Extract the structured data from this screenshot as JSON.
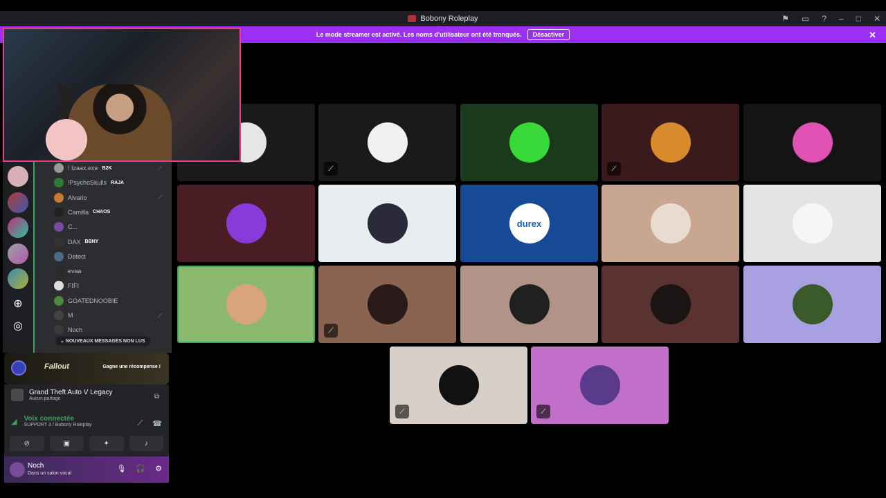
{
  "window": {
    "title": "Bobony Roleplay",
    "controls": [
      "flag-icon",
      "inbox-icon",
      "help-icon",
      "minimize-icon",
      "maximize-icon",
      "close-icon"
    ]
  },
  "banner": {
    "text": "Le mode streamer est activé. Les noms d'utilisateur ont été tronqués.",
    "button": "Désactiver",
    "close": "✕"
  },
  "members": [
    {
      "name": "! Izaax.exe",
      "tag": "B2K",
      "muted": true,
      "color": "#9a9a9a"
    },
    {
      "name": "!PsychoSkulls",
      "tag": "RAJA",
      "muted": false,
      "color": "#2e7d32"
    },
    {
      "name": "Alvario",
      "tag": "",
      "muted": true,
      "color": "#c97a32"
    },
    {
      "name": "Camilla",
      "tag": "CHAOS",
      "muted": false,
      "color": "#222222"
    },
    {
      "name": "C...",
      "tag": "",
      "muted": false,
      "color": "#7a4aa0"
    },
    {
      "name": "DAX",
      "tag": "BBNY",
      "muted": false,
      "color": "#333333"
    },
    {
      "name": "Detect",
      "tag": "",
      "muted": false,
      "color": "#4a6a8a"
    },
    {
      "name": "evaa",
      "tag": "",
      "muted": false,
      "color": "#2a2a2a"
    },
    {
      "name": "FIFI",
      "tag": "",
      "muted": false,
      "color": "#dddddd"
    },
    {
      "name": "GOATEDNOOBIE",
      "tag": "",
      "muted": false,
      "color": "#4a8a3a"
    },
    {
      "name": "M",
      "tag": "",
      "muted": true,
      "color": "#444444"
    },
    {
      "name": "Noch",
      "tag": "",
      "muted": false,
      "color": "#3a3a3a"
    }
  ],
  "new_messages": "NOUVEAUX MESSAGES NON LUS",
  "promo": {
    "brand": "Fallout",
    "cta": "Gagne une récompense !"
  },
  "game": {
    "name": "Grand Theft Auto V Legacy",
    "status": "Aucun partage"
  },
  "voice": {
    "status": "Voix connectée",
    "channel": "SUPPORT 3 / Bobony Roleplay"
  },
  "user": {
    "name": "Noch",
    "status": "Dans un salon vocal"
  },
  "tiles": [
    {
      "bg": "#1a1a1a",
      "avatar": "#e6e6e6",
      "muted": false,
      "speaking": false
    },
    {
      "bg": "#1a1a1a",
      "avatar": "#f0f0f0",
      "muted": true,
      "speaking": false
    },
    {
      "bg": "#1b3a1b",
      "avatar": "#39d93a",
      "muted": false,
      "speaking": false
    },
    {
      "bg": "#3a1a1a",
      "avatar": "#d98a2a",
      "muted": true,
      "speaking": false
    },
    {
      "bg": "#141414",
      "avatar": "#e052b4",
      "muted": false,
      "speaking": false
    },
    {
      "bg": "#4a1c24",
      "avatar": "#8a3ad9",
      "muted": false,
      "speaking": false
    },
    {
      "bg": "#e8eef0",
      "avatar": "#2a2a3a",
      "muted": false,
      "speaking": false
    },
    {
      "bg": "#164a94",
      "avatar": "#ffffff",
      "muted": false,
      "speaking": false,
      "label": "durex"
    },
    {
      "bg": "#c8a690",
      "avatar": "#e8dcd0",
      "muted": false,
      "speaking": false
    },
    {
      "bg": "#e4e4e2",
      "avatar": "#f6f6f6",
      "muted": false,
      "speaking": false
    },
    {
      "bg": "#8cb870",
      "avatar": "#d9a47a",
      "muted": false,
      "speaking": true
    },
    {
      "bg": "#8a6452",
      "avatar": "#2a1a1a",
      "muted": true,
      "speaking": false
    },
    {
      "bg": "#b09488",
      "avatar": "#202020",
      "muted": false,
      "speaking": false
    },
    {
      "bg": "#5a3230",
      "avatar": "#1a1414",
      "muted": false,
      "speaking": false
    },
    {
      "bg": "#a8a0e0",
      "avatar": "#3a5a2a",
      "muted": false,
      "speaking": false
    },
    {
      "bg": "#d8d0c8",
      "avatar": "#111111",
      "muted": true,
      "speaking": false
    },
    {
      "bg": "#c070c8",
      "avatar": "#5a3a8a",
      "muted": true,
      "speaking": false
    }
  ]
}
